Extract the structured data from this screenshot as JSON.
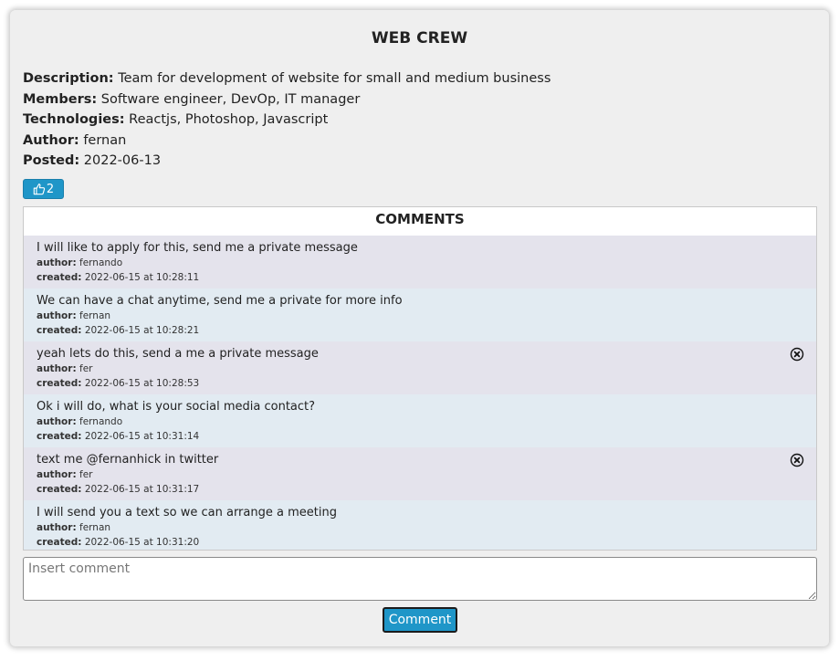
{
  "project": {
    "title": "WEB CREW",
    "fields": [
      {
        "label": "Description:",
        "value": "Team for development of website for small and medium business"
      },
      {
        "label": "Members:",
        "value": "Software engineer, DevOp, IT manager"
      },
      {
        "label": "Technologies:",
        "value": "Reactjs, Photoshop, Javascript"
      },
      {
        "label": "Author:",
        "value": "fernan"
      },
      {
        "label": "Posted:",
        "value": "2022-06-13"
      }
    ],
    "likes": "2"
  },
  "comments": {
    "header": "COMMENTS",
    "author_label": "author:",
    "created_label": "created:",
    "items": [
      {
        "text": "I will like to apply for this, send me a private message",
        "author": "fernando",
        "created": "2022-06-15 at 10:28:11",
        "deletable": false
      },
      {
        "text": "We can have a chat anytime, send me a private for more info",
        "author": "fernan",
        "created": "2022-06-15 at 10:28:21",
        "deletable": false
      },
      {
        "text": "yeah lets do this, send a me a private message",
        "author": "fer",
        "created": "2022-06-15 at 10:28:53",
        "deletable": true
      },
      {
        "text": "Ok i will do, what is your social media contact?",
        "author": "fernando",
        "created": "2022-06-15 at 10:31:14",
        "deletable": false
      },
      {
        "text": "text me @fernanhick in twitter",
        "author": "fer",
        "created": "2022-06-15 at 10:31:17",
        "deletable": true
      },
      {
        "text": "I will send you a text so we can arrange a meeting",
        "author": "fernan",
        "created": "2022-06-15 at 10:31:20",
        "deletable": false
      }
    ]
  },
  "comment_form": {
    "placeholder": "Insert comment",
    "value": "",
    "submit_label": "Comment"
  },
  "icons": {
    "like": "thumbs-up-icon",
    "delete": "close-circle-icon"
  },
  "colors": {
    "accent": "#1f96c8",
    "comment_bg_odd": "#e4e3ec",
    "comment_bg_even": "#e2ebf2"
  }
}
